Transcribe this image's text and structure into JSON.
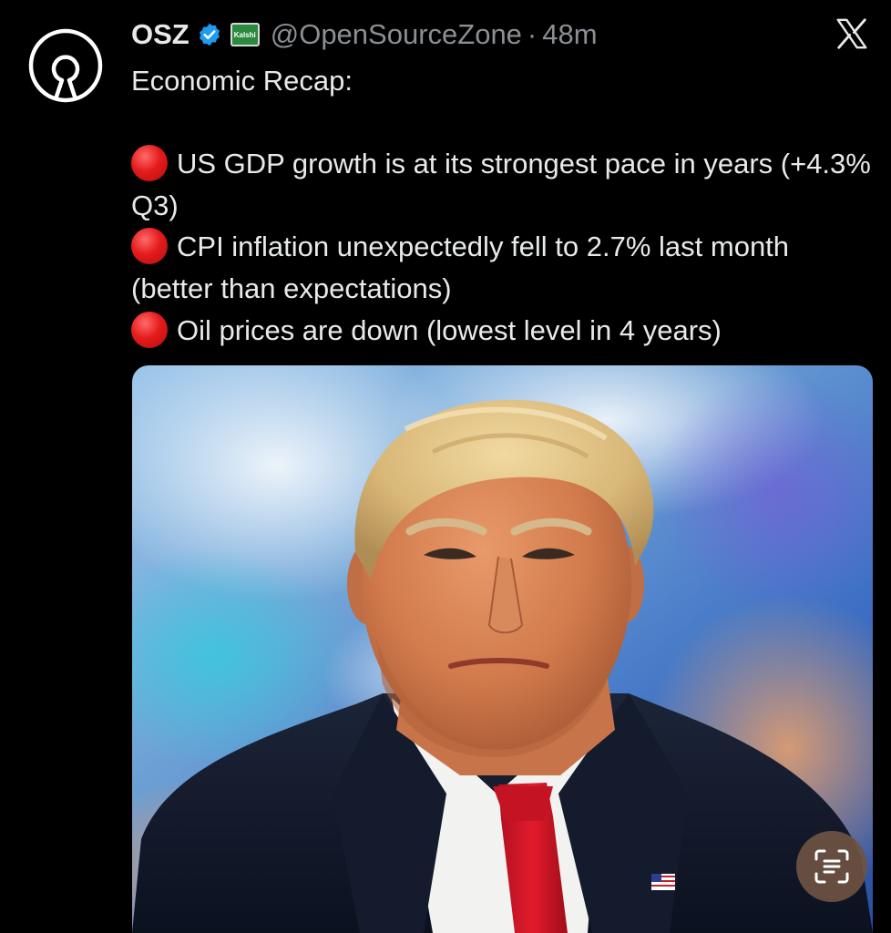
{
  "tweet": {
    "author": {
      "display_name": "OSZ",
      "handle": "@OpenSourceZone",
      "verified": true,
      "affiliate_badge": "Kalshi",
      "avatar_icon": "open-source-keyhole-logo"
    },
    "separator": "·",
    "timestamp": "48m",
    "platform_icon": "x-logo-icon",
    "lines": [
      {
        "text": "Economic Recap:"
      },
      {
        "text": ""
      },
      {
        "text": "US GDP growth is at its strongest pace in years (+4.3% Q3)",
        "marker": "red-circle-emoji"
      },
      {
        "text": "CPI inflation unexpectedly fell to 2.7% last month (better than expectations)",
        "marker": "red-circle-emoji"
      },
      {
        "text": "Oil prices are down (lowest level in 4 years)",
        "marker": "red-circle-emoji"
      }
    ],
    "media": {
      "type": "photo",
      "scan_button_icon": "text-scan-icon"
    }
  },
  "colors": {
    "background": "#000000",
    "text_primary": "#e7e9ea",
    "text_secondary": "#8b8f94",
    "verified_blue": "#1d9bf0",
    "affiliate_green": "#2b8a3e",
    "bullet_red": "#e51b1b"
  }
}
